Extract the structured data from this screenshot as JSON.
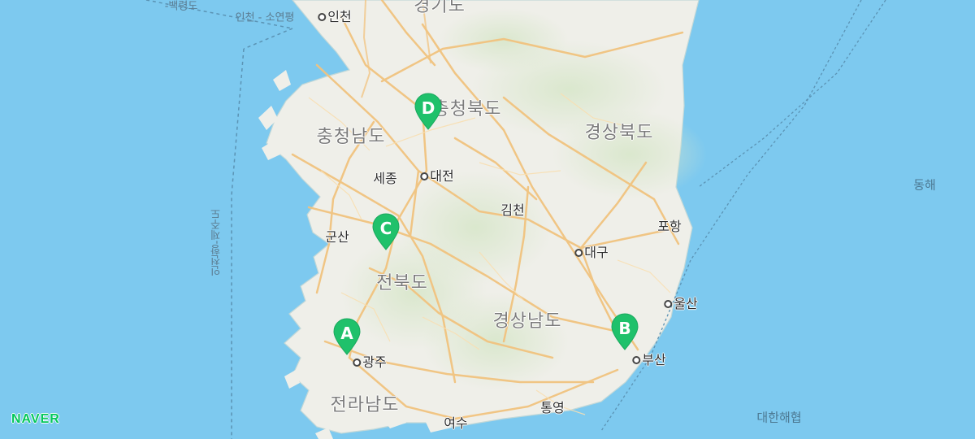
{
  "map": {
    "province_labels": [
      "경기도",
      "충청북도",
      "충청남도",
      "경상북도",
      "전북도",
      "경상남도",
      "전라남도"
    ],
    "city_labels": [
      "인천",
      "세종",
      "대전",
      "김천",
      "군산",
      "대구",
      "포항",
      "울산",
      "광주",
      "부산",
      "통영",
      "여수"
    ],
    "sea_labels": [
      "동해",
      "대한해협"
    ],
    "route_labels": [
      "인천 - 소연평",
      "인천항-제주도",
      "-백령도"
    ],
    "markers": [
      "A",
      "B",
      "C",
      "D"
    ],
    "logo": "NAVER",
    "colors": {
      "sea": "#7dc9ef",
      "land": "#efefe9",
      "road": "#f4c98b",
      "marker": "#1fc16b"
    }
  }
}
